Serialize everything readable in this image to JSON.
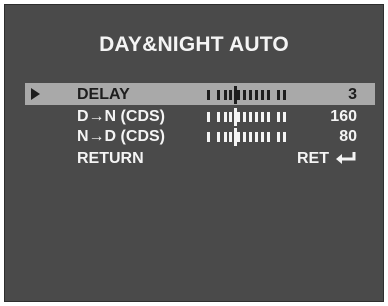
{
  "menu": {
    "title": "DAY&NIGHT AUTO",
    "items": [
      {
        "label": "DELAY",
        "value": "3",
        "level": 0.35,
        "selected": true
      },
      {
        "label": "D→N (CDS)",
        "value": "160",
        "level": 0.35,
        "selected": false
      },
      {
        "label": "N→D (CDS)",
        "value": "80",
        "level": 0.35,
        "selected": false
      },
      {
        "label": "RETURN",
        "value": "RET",
        "selected": false
      }
    ]
  },
  "colors": {
    "background": "#4a4a4a",
    "text": "#f4f4f4",
    "highlight": "#a9a9a9",
    "highlight_text": "#1e1e1e"
  },
  "icons": {
    "cursor": "triangle-right-icon",
    "return": "return-arrow-icon"
  }
}
